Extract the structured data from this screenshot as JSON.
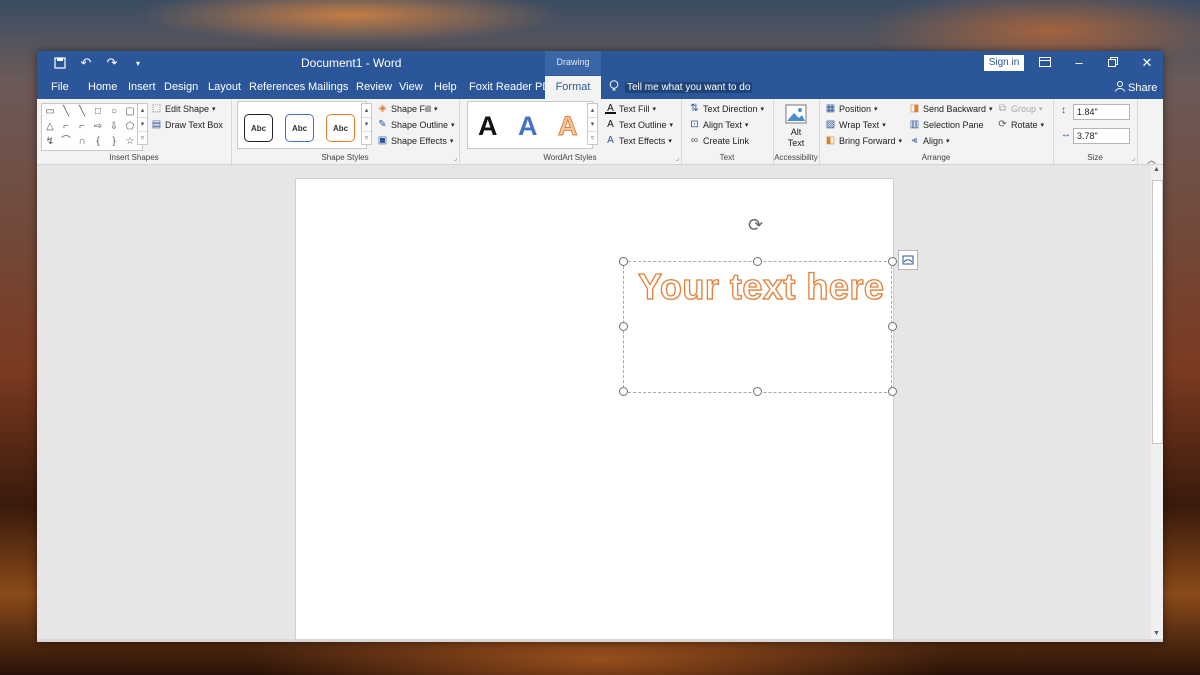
{
  "window": {
    "title": "Document1 - Word",
    "context_header": "Drawing Tools",
    "sign_in": "Sign in"
  },
  "tabs": {
    "items": [
      "File",
      "Home",
      "Insert",
      "Design",
      "Layout",
      "References",
      "Mailings",
      "Review",
      "View",
      "Help",
      "Foxit Reader PDF"
    ],
    "active": "Format",
    "tell_me": "Tell me what you want to do",
    "share": "Share"
  },
  "ribbon": {
    "insert_shapes": {
      "label": "Insert Shapes",
      "edit_shape": "Edit Shape",
      "draw_text_box": "Draw Text Box"
    },
    "shape_styles": {
      "label": "Shape Styles",
      "style_sample": "Abc",
      "shape_fill": "Shape Fill",
      "shape_outline": "Shape Outline",
      "shape_effects": "Shape Effects"
    },
    "wordart_styles": {
      "label": "WordArt Styles",
      "sample": "A",
      "text_fill": "Text Fill",
      "text_outline": "Text Outline",
      "text_effects": "Text Effects"
    },
    "text": {
      "label": "Text",
      "text_direction": "Text Direction",
      "align_text": "Align Text",
      "create_link": "Create Link"
    },
    "accessibility": {
      "label": "Accessibility",
      "alt_text_line1": "Alt",
      "alt_text_line2": "Text"
    },
    "arrange": {
      "label": "Arrange",
      "position": "Position",
      "wrap_text": "Wrap Text",
      "bring_forward": "Bring Forward",
      "send_backward": "Send Backward",
      "selection_pane": "Selection Pane",
      "align": "Align",
      "group": "Group",
      "rotate": "Rotate"
    },
    "size": {
      "label": "Size",
      "height": "1.84\"",
      "width": "3.78\""
    }
  },
  "document": {
    "wordart_text": "Your text here"
  },
  "colors": {
    "accent": "#2b579a",
    "wordart_outline": "#e2813a"
  }
}
